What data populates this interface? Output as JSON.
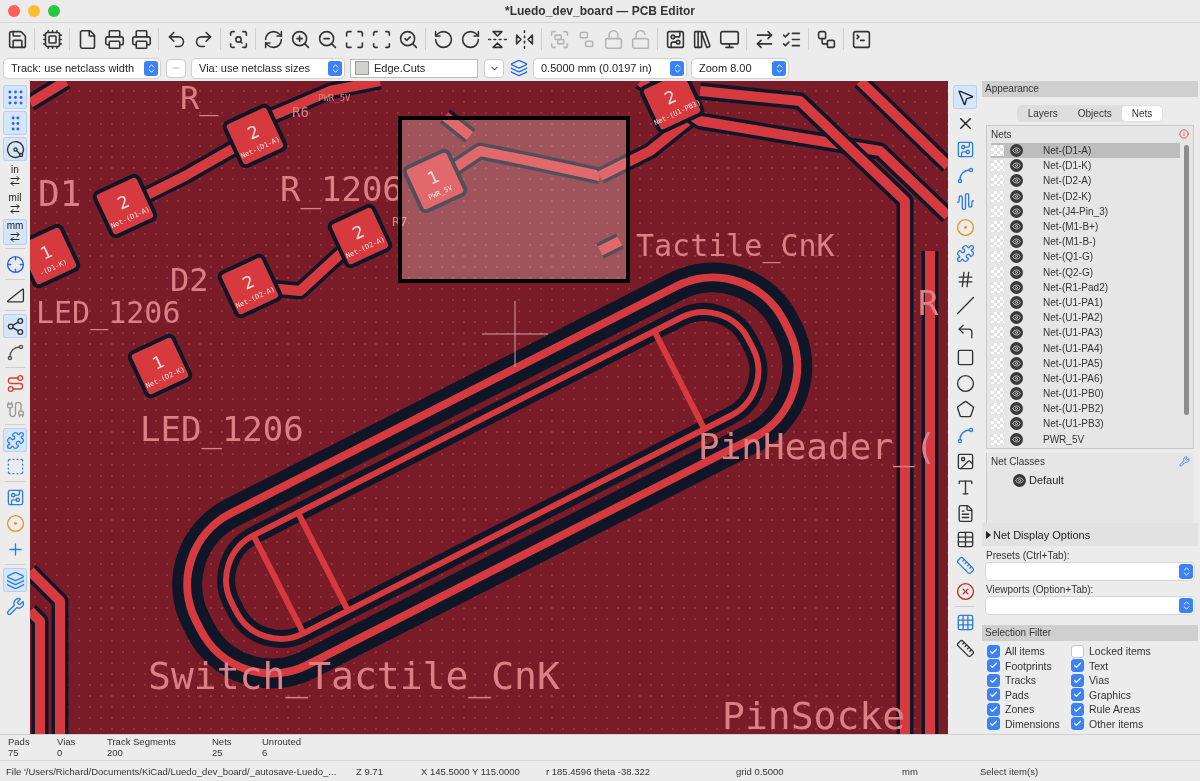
{
  "window": {
    "title": "*Luedo_dev_board — PCB Editor"
  },
  "toolbar": [
    {
      "disabled": false
    },
    {
      "disabled": false
    },
    {
      "disabled": false
    },
    {
      "disabled": false
    },
    {
      "disabled": false
    },
    {
      "disabled": false
    },
    {
      "disabled": false
    },
    {
      "disabled": false
    },
    {
      "disabled": false
    },
    {
      "disabled": false
    },
    {
      "disabled": false
    },
    {
      "disabled": false
    },
    {
      "disabled": false
    },
    {
      "disabled": false
    },
    {
      "disabled": false
    },
    {
      "disabled": false
    },
    {
      "disabled": false
    },
    {
      "disabled": false
    },
    {
      "disabled": true
    },
    {
      "disabled": true
    },
    {
      "disabled": true
    },
    {
      "disabled": true
    },
    {
      "disabled": false
    },
    {
      "disabled": false
    },
    {
      "disabled": false
    },
    {
      "disabled": false
    },
    {
      "disabled": false
    },
    {
      "disabled": false
    },
    {
      "disabled": false
    }
  ],
  "options": {
    "track_width": "Track: use netclass width",
    "via_size": "Via: use netclass sizes",
    "layer": "Edge.Cuts",
    "grid": "0.5000 mm (0.0197 in)",
    "zoom": "Zoom 8.00"
  },
  "left_toolbar": [
    {
      "selected": true
    },
    {
      "selected": true
    },
    {
      "selected": true
    },
    {
      "selected": false,
      "label": "in"
    },
    {
      "selected": false,
      "label": "mil"
    },
    {
      "selected": true,
      "label": "mm"
    },
    {
      "selected": false
    },
    {
      "selected": false
    },
    {
      "selected": true
    },
    {
      "selected": false
    },
    {
      "selected": false
    },
    {
      "selected": false
    },
    {
      "selected": true
    },
    {
      "selected": false
    },
    {
      "selected": false
    },
    {
      "selected": false
    },
    {
      "selected": false
    },
    {
      "selected": true
    },
    {
      "selected": false
    }
  ],
  "canvas": {
    "labels": [
      "R_",
      "R6",
      "PWR_5V",
      "D1",
      "R_1206",
      "R7",
      "Tactile_CnK",
      "D2",
      "R",
      "LED_1206",
      "LED_1206",
      "PinHeader_(",
      "Switch_Tactile_CnK",
      "PinSocke"
    ],
    "pads": [
      {
        "number": "2",
        "net": "Net-(D1-A)"
      },
      {
        "number": "2",
        "net": "Net-(D1-A)"
      },
      {
        "number": "1",
        "net": "-(D1-K)"
      },
      {
        "number": "2",
        "net": "Net-(D2-A)"
      },
      {
        "number": "2",
        "net": "Net-(D2-A)"
      },
      {
        "number": "1",
        "net": "Net-(D2-K)"
      },
      {
        "number": "1",
        "net": "PWR_5V"
      },
      {
        "number": "2",
        "net": "Net-(U1-PB3)"
      }
    ]
  },
  "right_toolbar": [
    {
      "selected": true
    },
    {
      "selected": false
    },
    {
      "selected": false
    },
    {
      "selected": false
    },
    {
      "selected": false
    },
    {
      "selected": false
    },
    {
      "selected": false
    },
    {
      "selected": false
    },
    {
      "selected": false
    },
    {
      "selected": false
    },
    {
      "selected": false
    },
    {
      "selected": false
    },
    {
      "selected": false
    },
    {
      "selected": false
    },
    {
      "selected": false
    },
    {
      "selected": false
    },
    {
      "selected": false
    },
    {
      "selected": false
    },
    {
      "selected": false
    },
    {
      "selected": false
    },
    {
      "selected": false
    },
    {
      "selected": false
    }
  ],
  "appearance": {
    "title": "Appearance",
    "tabs": [
      {
        "label": "Layers",
        "selected": false
      },
      {
        "label": "Objects",
        "selected": false
      },
      {
        "label": "Nets",
        "selected": true
      }
    ],
    "nets_title": "Nets",
    "nets": [
      {
        "name": "Net-(D1-A)",
        "selected": true,
        "visible": true
      },
      {
        "name": "Net-(D1-K)",
        "selected": false,
        "visible": true
      },
      {
        "name": "Net-(D2-A)",
        "selected": false,
        "visible": true
      },
      {
        "name": "Net-(D2-K)",
        "selected": false,
        "visible": true
      },
      {
        "name": "Net-(J4-Pin_3)",
        "selected": false,
        "visible": true
      },
      {
        "name": "Net-(M1-B+)",
        "selected": false,
        "visible": true
      },
      {
        "name": "Net-(M1-B-)",
        "selected": false,
        "visible": true
      },
      {
        "name": "Net-(Q1-G)",
        "selected": false,
        "visible": true
      },
      {
        "name": "Net-(Q2-G)",
        "selected": false,
        "visible": true
      },
      {
        "name": "Net-(R1-Pad2)",
        "selected": false,
        "visible": true
      },
      {
        "name": "Net-(U1-PA1)",
        "selected": false,
        "visible": true
      },
      {
        "name": "Net-(U1-PA2)",
        "selected": false,
        "visible": true
      },
      {
        "name": "Net-(U1-PA3)",
        "selected": false,
        "visible": true
      },
      {
        "name": "Net-(U1-PA4)",
        "selected": false,
        "visible": true
      },
      {
        "name": "Net-(U1-PA5)",
        "selected": false,
        "visible": true
      },
      {
        "name": "Net-(U1-PA6)",
        "selected": false,
        "visible": true
      },
      {
        "name": "Net-(U1-PB0)",
        "selected": false,
        "visible": true
      },
      {
        "name": "Net-(U1-PB2)",
        "selected": false,
        "visible": true
      },
      {
        "name": "Net-(U1-PB3)",
        "selected": false,
        "visible": true
      },
      {
        "name": "PWR_5V",
        "selected": false,
        "visible": true
      }
    ],
    "net_classes_title": "Net Classes",
    "net_classes": [
      {
        "name": "Default",
        "visible": true
      }
    ],
    "net_display_options": {
      "label": "Net Display Options",
      "expanded": false
    },
    "presets_label": "Presets (Ctrl+Tab):",
    "viewports_label": "Viewports (Option+Tab):"
  },
  "selection_filter": {
    "title": "Selection Filter",
    "items": [
      {
        "label": "All items",
        "checked": true
      },
      {
        "label": "Locked items",
        "checked": false
      },
      {
        "label": "Footprints",
        "checked": true
      },
      {
        "label": "Text",
        "checked": true
      },
      {
        "label": "Tracks",
        "checked": true
      },
      {
        "label": "Vias",
        "checked": true
      },
      {
        "label": "Pads",
        "checked": true
      },
      {
        "label": "Graphics",
        "checked": true
      },
      {
        "label": "Zones",
        "checked": true
      },
      {
        "label": "Rule Areas",
        "checked": true
      },
      {
        "label": "Dimensions",
        "checked": true
      },
      {
        "label": "Other items",
        "checked": true
      }
    ]
  },
  "stats": [
    {
      "label": "Pads",
      "value": "75"
    },
    {
      "label": "Vias",
      "value": "0"
    },
    {
      "label": "Track Segments",
      "value": "200"
    },
    {
      "label": "Nets",
      "value": "25"
    },
    {
      "label": "Unrouted",
      "value": "6"
    }
  ],
  "status_bar": [
    "File '/Users/Richard/Documents/KiCad/Luedo_dev_board/_autosave-Luedo_...",
    "Z 9.71",
    "X 145.5000  Y 115.0000",
    "r 185.4596  theta -38.322",
    "grid 0.5000",
    "mm",
    "Select item(s)"
  ]
}
